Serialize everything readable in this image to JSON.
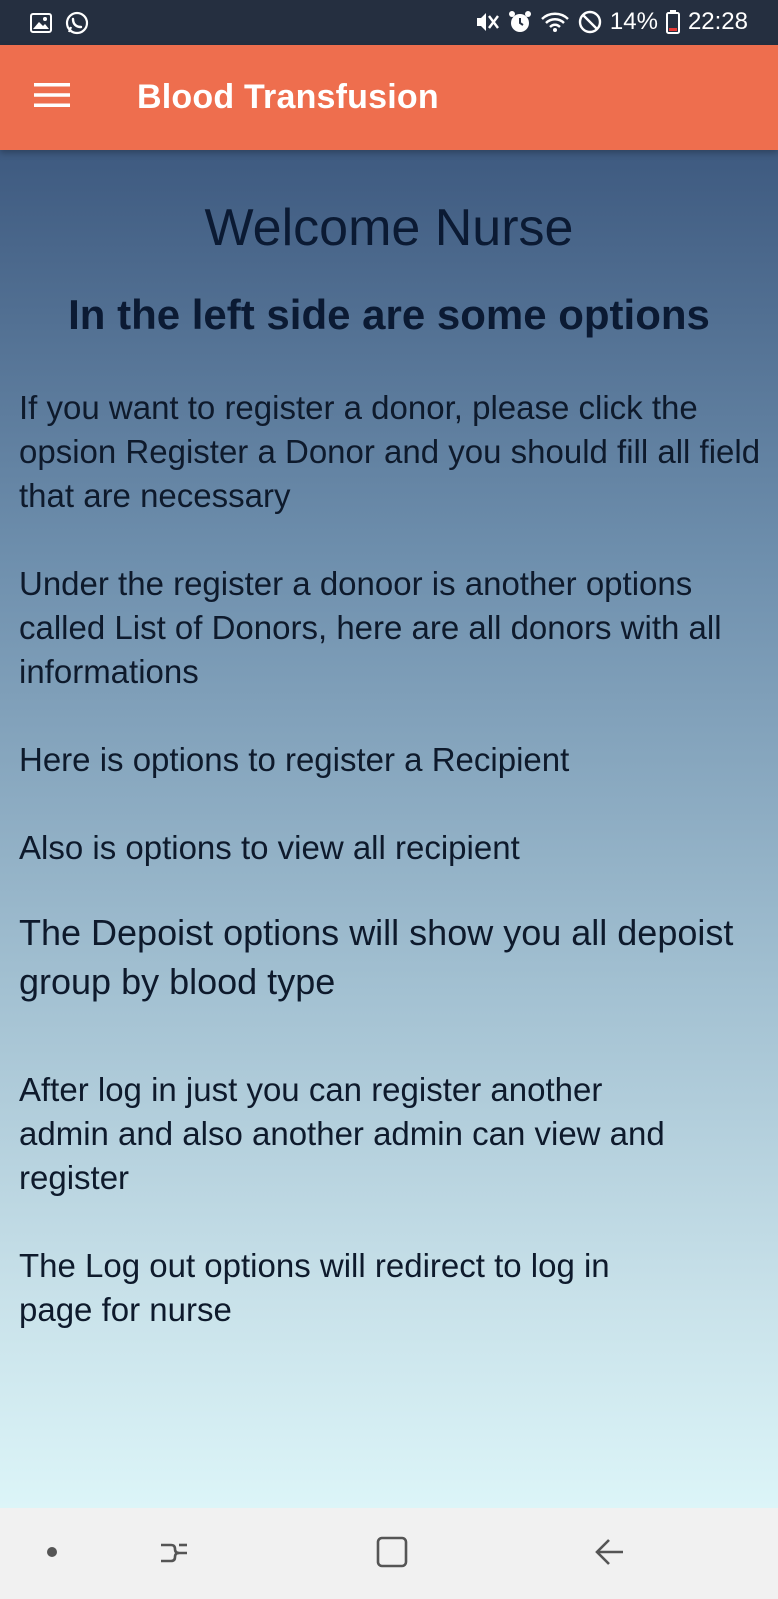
{
  "status_bar": {
    "left_icons": [
      "gallery-icon",
      "whatsapp-icon"
    ],
    "right_icons": [
      "mute-vibrate-icon",
      "alarm-icon",
      "wifi-icon",
      "do-not-disturb-icon"
    ],
    "battery": "14%",
    "time": "22:28"
  },
  "app_bar": {
    "menu_icon": "hamburger-menu-icon",
    "title": "Blood Transfusion",
    "color": "#ee6e4e"
  },
  "content": {
    "welcome": "Welcome Nurse",
    "subtitle": "In the left side are some options",
    "paragraphs": [
      "If you want to register a donor, please click the opsion Register a Donor and you should fill all field that are necessary",
      "Under the register a donoor is another options called List of Donors, here are all donors with all informations",
      "Here is options to register a Recipient",
      "Also is options to view all recipient",
      "The Depoist options will show you all depoist group by blood type",
      "After log in just you can register another admin and also another admin can view and register",
      "The Log out options will redirect to log in page for nurse"
    ]
  },
  "nav_bar": {
    "icons": [
      "dot-icon",
      "recent-apps-icon",
      "home-icon",
      "back-icon"
    ]
  }
}
